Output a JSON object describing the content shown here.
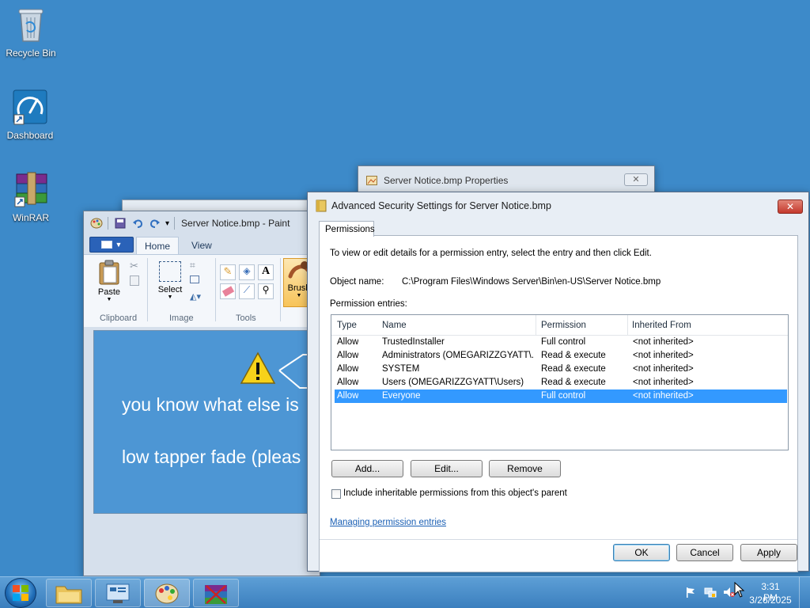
{
  "desktop": {
    "icons": [
      {
        "label": "Recycle Bin",
        "icon": "recycle-bin-icon"
      },
      {
        "label": "Dashboard",
        "icon": "dashboard-icon"
      },
      {
        "label": "WinRAR",
        "icon": "winrar-icon"
      }
    ]
  },
  "paint": {
    "title": "Server Notice.bmp - Paint",
    "tabs": [
      "Home",
      "View"
    ],
    "paste_label": "Paste",
    "select_label": "Select",
    "brush_label": "Brush",
    "groups": [
      "Clipboard",
      "Image",
      "Tools"
    ],
    "canvas_line1": "you know what else is",
    "canvas_line2": "low tapper fade (pleas"
  },
  "properties": {
    "title": "Server Notice.bmp Properties"
  },
  "advanced": {
    "title": "Advanced Security Settings for Server Notice.bmp",
    "tab": "Permissions",
    "instructions": "To view or edit details for a permission entry, select the entry and then click Edit.",
    "object_name_label": "Object name:",
    "object_name_value": "C:\\Program Files\\Windows Server\\Bin\\en-US\\Server Notice.bmp",
    "entries_label": "Permission entries:",
    "columns": [
      "Type",
      "Name",
      "Permission",
      "Inherited From"
    ],
    "rows": [
      {
        "type": "Allow",
        "name": "TrustedInstaller",
        "permission": "Full control",
        "inherited": "<not inherited>"
      },
      {
        "type": "Allow",
        "name": "Administrators (OMEGARIZZGYATT\\...",
        "permission": "Read & execute",
        "inherited": "<not inherited>"
      },
      {
        "type": "Allow",
        "name": "SYSTEM",
        "permission": "Read & execute",
        "inherited": "<not inherited>"
      },
      {
        "type": "Allow",
        "name": "Users (OMEGARIZZGYATT\\Users)",
        "permission": "Read & execute",
        "inherited": "<not inherited>"
      },
      {
        "type": "Allow",
        "name": "Everyone",
        "permission": "Full control",
        "inherited": "<not inherited>"
      }
    ],
    "selected_row": 4,
    "add_label": "Add...",
    "edit_label": "Edit...",
    "remove_label": "Remove",
    "include_label": "Include inheritable permissions from this object's parent",
    "include_checked": false,
    "link_label": "Managing permission entries",
    "ok_label": "OK",
    "cancel_label": "Cancel",
    "apply_label": "Apply"
  },
  "taskbar": {
    "time": "3:31 PM",
    "date": "3/26/2025"
  },
  "colors": {
    "desktop": "#3d8ac9",
    "selection": "#3399ff",
    "close_button": "#c9463d",
    "link": "#1a5fb4"
  }
}
